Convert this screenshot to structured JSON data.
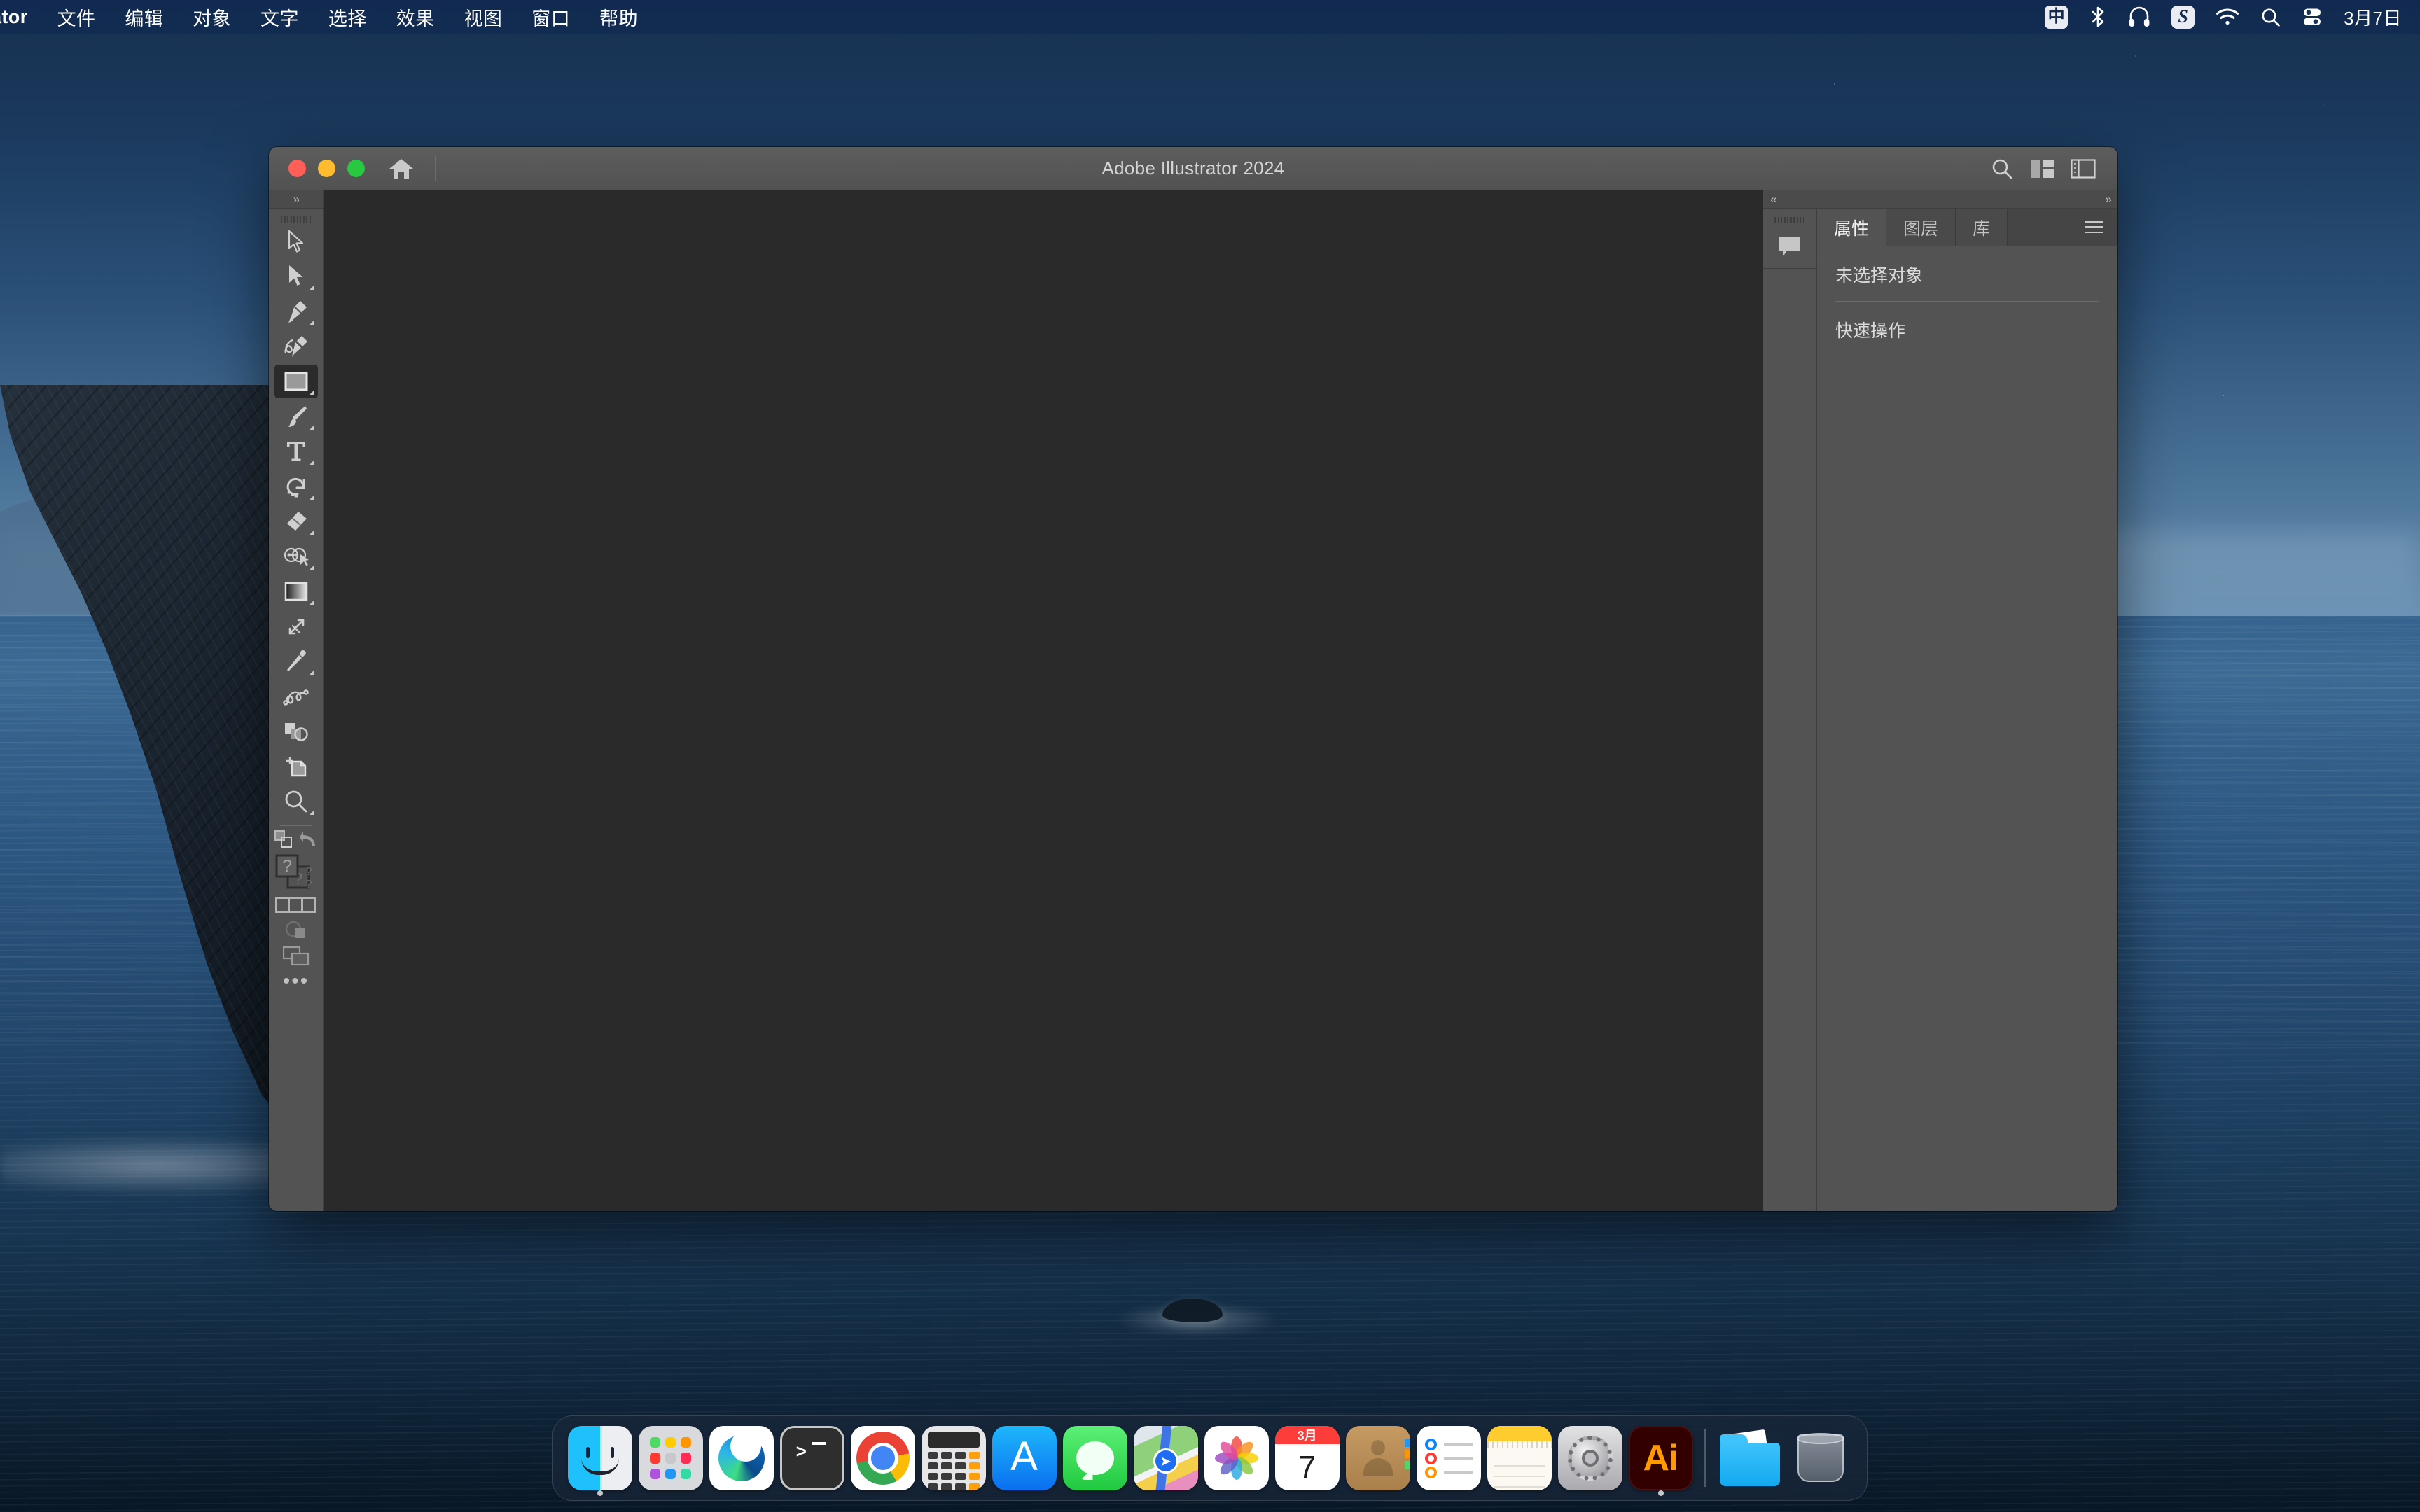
{
  "menubar": {
    "app_name": "ator",
    "items": [
      {
        "label": "文件"
      },
      {
        "label": "编辑"
      },
      {
        "label": "对象"
      },
      {
        "label": "文字"
      },
      {
        "label": "选择"
      },
      {
        "label": "效果"
      },
      {
        "label": "视图"
      },
      {
        "label": "窗口"
      },
      {
        "label": "帮助"
      }
    ],
    "status": {
      "input_method": "中",
      "bluetooth_icon": "bluetooth-icon",
      "headphones_icon": "headphones-icon",
      "snipaste_label": "S",
      "wifi_icon": "wifi-icon",
      "search_icon": "spotlight-search-icon",
      "control_center_icon": "control-center-icon",
      "clock": "3月7日"
    }
  },
  "window": {
    "title": "Adobe Illustrator 2024",
    "traffic_lights": {
      "close": "close-button",
      "minimize": "minimize-button",
      "zoom": "zoom-button"
    },
    "home_icon": "home-icon",
    "toolbar_right": {
      "search_icon": "search-icon",
      "arrange_icon": "arrange-documents-icon",
      "panel_toggle_icon": "panel-toggle-icon"
    }
  },
  "toolpanel": {
    "collapse_label": "»",
    "tools": [
      {
        "name": "selection-tool",
        "has_flyout": false,
        "selected": false
      },
      {
        "name": "direct-selection-tool",
        "has_flyout": true,
        "selected": false
      },
      {
        "name": "pen-tool",
        "has_flyout": true,
        "selected": false
      },
      {
        "name": "curvature-tool",
        "has_flyout": false,
        "selected": false
      },
      {
        "name": "rectangle-tool",
        "has_flyout": true,
        "selected": true
      },
      {
        "name": "paintbrush-tool",
        "has_flyout": true,
        "selected": false
      },
      {
        "name": "type-tool",
        "has_flyout": true,
        "selected": false
      },
      {
        "name": "rotate-tool",
        "has_flyout": true,
        "selected": false
      },
      {
        "name": "eraser-tool",
        "has_flyout": true,
        "selected": false
      },
      {
        "name": "shape-builder-tool",
        "has_flyout": true,
        "selected": false
      },
      {
        "name": "gradient-tool",
        "has_flyout": true,
        "selected": false
      },
      {
        "name": "width-tool",
        "has_flyout": false,
        "selected": false
      },
      {
        "name": "eyedropper-tool",
        "has_flyout": true,
        "selected": false
      },
      {
        "name": "blend-tool",
        "has_flyout": false,
        "selected": false
      },
      {
        "name": "symbol-sprayer-tool",
        "has_flyout": false,
        "selected": false
      },
      {
        "name": "artboard-tool",
        "has_flyout": false,
        "selected": false
      },
      {
        "name": "zoom-tool",
        "has_flyout": true,
        "selected": false
      }
    ],
    "fill_stroke": {
      "swap_icon": "swap-fill-stroke-icon",
      "default_icon": "default-fill-stroke-icon",
      "fill_value": "?",
      "stroke_value": "?"
    },
    "color_modes": "color-mode-buttons",
    "drawing_modes": "drawing-modes-icon",
    "screen_mode": "screen-mode-icon",
    "more_label": "•••"
  },
  "panels": {
    "collapse_left_label": "«",
    "collapse_right_label": "»",
    "rail": [
      {
        "name": "comments-panel-icon"
      }
    ],
    "tabs": [
      {
        "label": "属性",
        "active": true
      },
      {
        "label": "图层",
        "active": false
      },
      {
        "label": "库",
        "active": false
      }
    ],
    "menu_icon": "panel-menu-icon",
    "no_selection_label": "未选择对象",
    "quick_actions_label": "快速操作"
  },
  "dock": {
    "items": [
      {
        "name": "finder",
        "running": true
      },
      {
        "name": "launchpad",
        "running": false
      },
      {
        "name": "microsoft-edge",
        "running": false
      },
      {
        "name": "terminal",
        "running": false
      },
      {
        "name": "google-chrome",
        "running": false
      },
      {
        "name": "calculator",
        "running": false
      },
      {
        "name": "app-store",
        "running": false
      },
      {
        "name": "messages",
        "running": false
      },
      {
        "name": "maps",
        "running": false
      },
      {
        "name": "photos",
        "running": false
      },
      {
        "name": "calendar",
        "running": false,
        "month": "3月",
        "day": "7"
      },
      {
        "name": "contacts",
        "running": false
      },
      {
        "name": "reminders",
        "running": false
      },
      {
        "name": "notes",
        "running": false
      },
      {
        "name": "system-settings",
        "running": false
      },
      {
        "name": "adobe-illustrator",
        "running": true
      }
    ],
    "right_items": [
      {
        "name": "downloads-folder"
      },
      {
        "name": "trash"
      }
    ]
  },
  "colors": {
    "menubar_bg": "#112a51",
    "window_chrome": "#535353",
    "canvas_bg": "#2a2a2a",
    "panel_bg": "#535353",
    "panel_tab_bg": "#454545",
    "accent_orange": "#ff9a00",
    "traffic_red": "#ff5f57",
    "traffic_yellow": "#febc2e",
    "traffic_green": "#28c840"
  }
}
